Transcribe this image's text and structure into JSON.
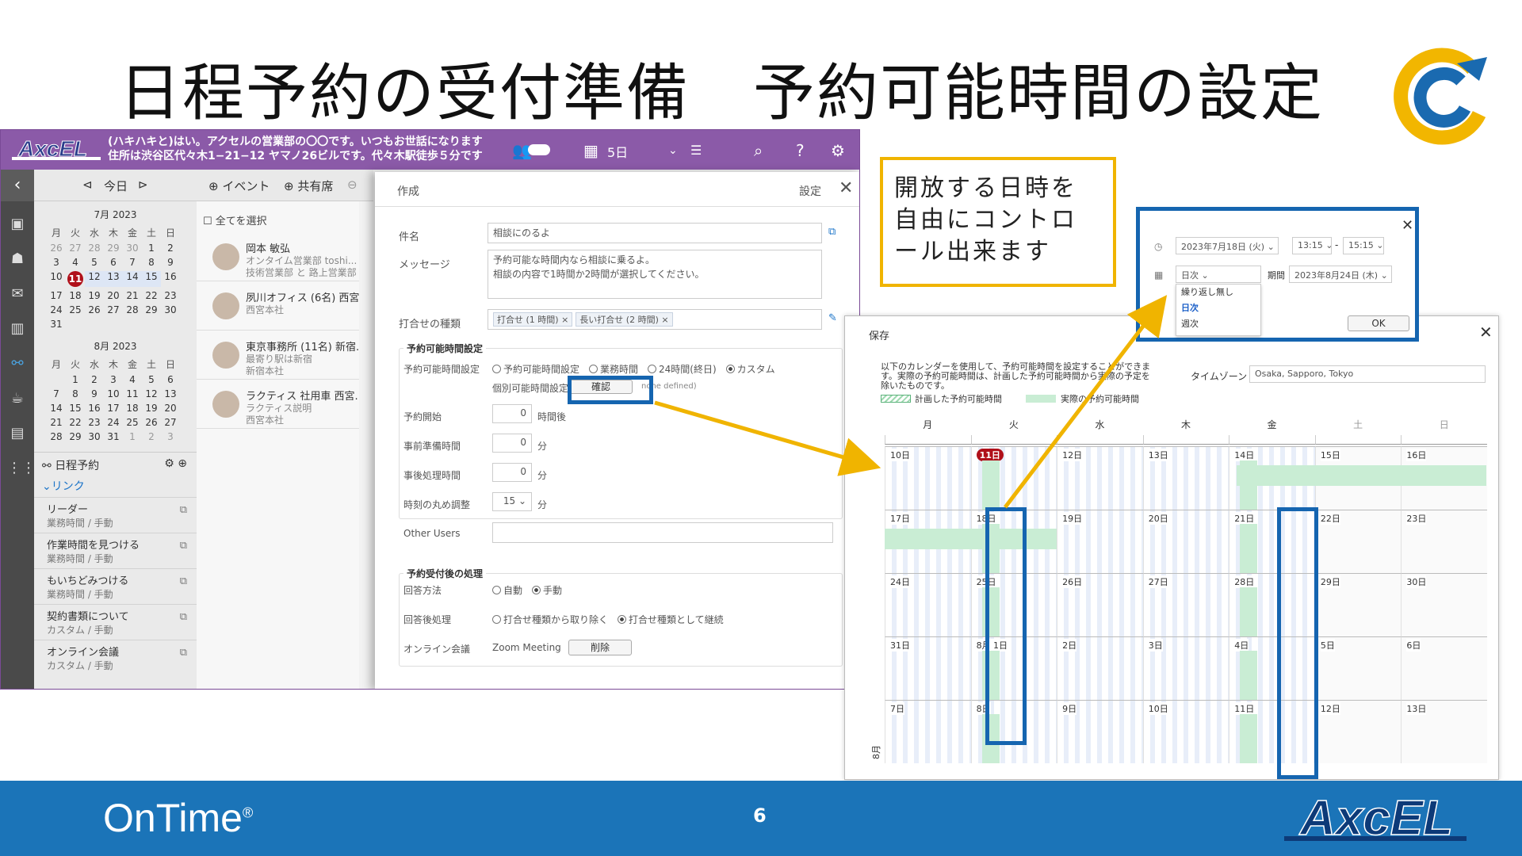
{
  "slide": {
    "title": "日程予約の受付準備　予約可能時間の設定",
    "page": "6",
    "brand": "OnTime",
    "brand_mark": "®"
  },
  "callout": {
    "text": "開放する日時を自由にコントロール出来ます"
  },
  "app": {
    "topbar": {
      "message_line1": "(ハキハキと)はい。アクセルの営業部の〇〇です。いつもお世話になります",
      "message_line2": "住所は渋谷区代々木1−21−12 ヤマノ26ビルです。代々木駅徒歩５分です",
      "days": "5日"
    },
    "subbar": {
      "today": "今日",
      "event": "イベント",
      "shared": "共有席"
    },
    "july": {
      "title": "7月 2023",
      "weekdays": [
        "月",
        "火",
        "水",
        "木",
        "金",
        "土",
        "日"
      ],
      "rows": [
        [
          "26",
          "27",
          "28",
          "29",
          "30",
          "1",
          "2"
        ],
        [
          "3",
          "4",
          "5",
          "6",
          "7",
          "8",
          "9"
        ],
        [
          "10",
          "11",
          "12",
          "13",
          "14",
          "15",
          "16"
        ],
        [
          "17",
          "18",
          "19",
          "20",
          "21",
          "22",
          "23"
        ],
        [
          "24",
          "25",
          "26",
          "27",
          "28",
          "29",
          "30"
        ],
        [
          "31",
          "",
          "",
          "",
          "",
          "",
          ""
        ]
      ]
    },
    "august": {
      "title": "8月 2023",
      "weekdays": [
        "月",
        "火",
        "水",
        "木",
        "金",
        "土",
        "日"
      ],
      "rows": [
        [
          "",
          "1",
          "2",
          "3",
          "4",
          "5",
          "6"
        ],
        [
          "7",
          "8",
          "9",
          "10",
          "11",
          "12",
          "13"
        ],
        [
          "14",
          "15",
          "16",
          "17",
          "18",
          "19",
          "20"
        ],
        [
          "21",
          "22",
          "23",
          "24",
          "25",
          "26",
          "27"
        ],
        [
          "28",
          "29",
          "30",
          "31",
          "1",
          "2",
          "3"
        ]
      ]
    },
    "scheduler": {
      "title": "日程予約",
      "links_label": "リンク",
      "links": [
        {
          "name": "リーダー",
          "sub": "業務時間 / 手動"
        },
        {
          "name": "作業時間を見つける",
          "sub": "業務時間 / 手動"
        },
        {
          "name": "もいちどみつける",
          "sub": "業務時間 / 手動"
        },
        {
          "name": "契約書類について",
          "sub": "カスタム / 手動"
        },
        {
          "name": "オンライン会議",
          "sub": "カスタム / 手動"
        }
      ]
    },
    "people": {
      "select_all": "全てを選択",
      "items": [
        {
          "name": "岡本 敏弘",
          "sub1": "オンタイム営業部 toshi...",
          "sub2": "技術営業部 と 路上営業部"
        },
        {
          "name": "夙川オフィス (6名) 西宮...",
          "sub1": "西宮本社",
          "sub2": ""
        },
        {
          "name": "東京事務所 (11名) 新宿...",
          "sub1": "最寄り駅は新宿",
          "sub2": "新宿本社"
        },
        {
          "name": "ラクティス 社用車 西宮...",
          "sub1": "ラクティス説明",
          "sub2": "西宮本社"
        }
      ]
    },
    "form": {
      "header": "作成",
      "settings": "設定",
      "subject_label": "件名",
      "subject": "相談にのるよ",
      "message_label": "メッセージ",
      "message_line1": "予約可能な時間内なら相談に乗るよ。",
      "message_line2": "相談の内容で1時間か2時間が選択してください。",
      "type_label": "打合せの種類",
      "types": [
        "打合せ (1 時間)",
        "長い打合せ (2 時間)"
      ],
      "avail_section": "予約可能時間設定",
      "avail_label": "予約可能時間設定",
      "avail_options": [
        "予約可能時間設定",
        "業務時間",
        "24時間(終日)",
        "カスタム"
      ],
      "individual_label": "個別可能時間設定",
      "confirm": "確認",
      "none_defined": "none defined)",
      "start_label": "予約開始",
      "start_value": "0",
      "start_unit": "時間後",
      "prep_label": "事前準備時間",
      "prep_value": "0",
      "prep_unit": "分",
      "post_label": "事後処理時間",
      "post_value": "0",
      "post_unit": "分",
      "round_label": "時刻の丸め調整",
      "round_value": "15",
      "round_unit": "分",
      "other_users": "Other Users",
      "after_section": "予約受付後の処理",
      "answer_label": "回答方法",
      "answer_options": [
        "自動",
        "手動"
      ],
      "post_answer_label": "回答後処理",
      "post_answer_options": [
        "打合せ種類から取り除く",
        "打合せ種類として継続"
      ],
      "online_label": "オンライン会議",
      "online_value": "Zoom Meeting",
      "delete": "削除"
    }
  },
  "avail_calendar": {
    "header": "保存",
    "desc_line1": "以下のカレンダーを使用して、予約可能時間を設定することができま",
    "desc_line2": "す。実際の予約可能時間は、計画した予約可能時間から実際の予定を",
    "desc_line3": "除いたものです。",
    "legend_planned": "計画した予約可能時間",
    "legend_actual": "実際の予約可能時間",
    "timezone_label": "タイムゾーン",
    "timezone": "Osaka, Sapporo, Tokyo",
    "weekdays": [
      "月",
      "火",
      "水",
      "木",
      "金",
      "土",
      "日"
    ],
    "weeks": [
      [
        "10日",
        "11日",
        "12日",
        "13日",
        "14日",
        "15日",
        "16日"
      ],
      [
        "17日",
        "18日",
        "19日",
        "20日",
        "21日",
        "22日",
        "23日"
      ],
      [
        "24日",
        "25日",
        "26日",
        "27日",
        "28日",
        "29日",
        "30日"
      ],
      [
        "31日",
        "8月 1日",
        "2日",
        "3日",
        "4日",
        "5日",
        "6日"
      ],
      [
        "7日",
        "8日",
        "9日",
        "10日",
        "11日",
        "12日",
        "13日"
      ]
    ],
    "month_label": "8月"
  },
  "popup": {
    "date": "2023年7月18日 (火)",
    "start": "13:15",
    "end": "15:15",
    "repeat": "日次",
    "period_label": "期間",
    "period": "2023年8月24日 (木)",
    "options": [
      "繰り返し無し",
      "日次",
      "週次"
    ],
    "ok": "OK"
  },
  "colors": {
    "purple": "#8b5aa8",
    "blue_highlight": "#1565b0",
    "yellow": "#f0b400",
    "green_avail": "#c9edd4",
    "footer": "#1b74b8"
  }
}
